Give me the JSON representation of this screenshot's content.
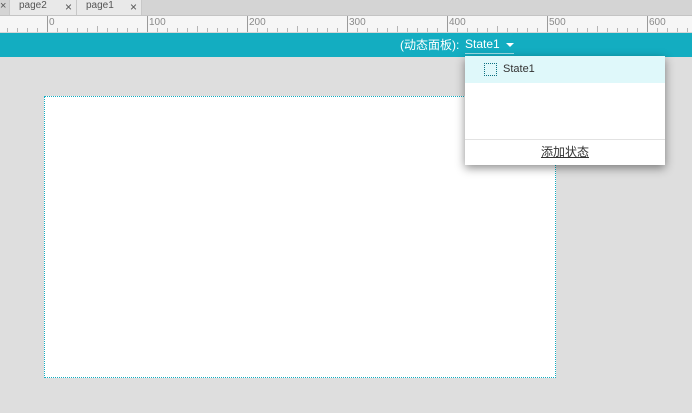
{
  "tabs": [
    {
      "label": "page2",
      "close_glyph": "×"
    },
    {
      "label": "page1",
      "close_glyph": "×"
    }
  ],
  "tab_stub_glyph": "×",
  "ruler": {
    "labels": [
      "0",
      "100",
      "200",
      "300",
      "400",
      "500",
      "600"
    ]
  },
  "panel": {
    "caption": "(动态面板):",
    "selected_state": "State1"
  },
  "dropdown": {
    "states": [
      {
        "label": "State1",
        "icon": "state-box-icon"
      }
    ],
    "add_state_label": "添加状态"
  },
  "colors": {
    "accent": "#13adc1",
    "selected_row": "#dff8fa",
    "canvas_bg": "#dedede"
  }
}
